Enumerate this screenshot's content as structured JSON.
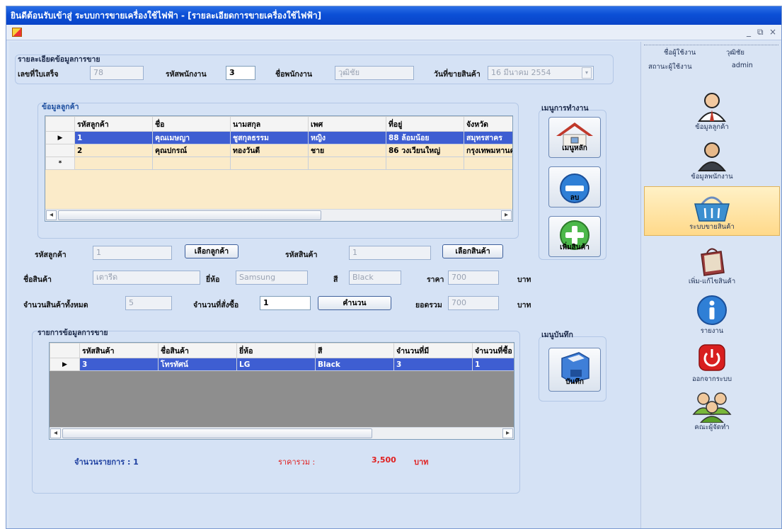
{
  "window": {
    "title": "ยินดีต้อนรับเข้าสู่ ระบบการขายเครื่องใช้ไฟฟ้า - [รายละเอียดการขายเครื่องใช้ไฟฟ้า]",
    "controls": [
      "_",
      "⧉",
      "×"
    ]
  },
  "sale_header": {
    "group_label": "รายละเอียดข้อมูลการขาย",
    "receipt_label": "เลขที่ใบเสร็จ",
    "receipt_value": "78",
    "employee_id_label": "รหัสพนักงาน",
    "employee_id_value": "3",
    "employee_name_label": "ชื่อพนักงาน",
    "employee_name_value": "วุฒิชัย",
    "sale_date_label": "วันที่ขายสินค้า",
    "sale_date_value": "16   มีนาคม    2554"
  },
  "customer": {
    "group_label": "ข้อมูลลูกค้า",
    "columns": [
      "รหัสลูกค้า",
      "ชื่อ",
      "นามสกุล",
      "เพศ",
      "ที่อยู่",
      "จังหวัด"
    ],
    "rows": [
      [
        "1",
        "คุณเมษญา",
        "ชูสกุลธรรม",
        "หญิง",
        "88 ล้อมน้อย",
        "สมุทรสาคร"
      ],
      [
        "2",
        "คุณปกรณ์",
        "ทองวันดี",
        "ชาย",
        "86 วงเวียนใหญ่",
        "กรุงเทพมหานคร"
      ]
    ],
    "new_row_marker": "*",
    "selected_marker": "▶"
  },
  "work_menu": {
    "label": "เมนูการทำงาน",
    "home": "เมนูหลัก",
    "delete": "ลบ",
    "add": "เพิ่มสินค้า"
  },
  "form": {
    "customer_id_label": "รหัสลูกค้า",
    "customer_id_value": "1",
    "choose_customer": "เลือกลูกค้า",
    "product_id_label": "รหัสสินค้า",
    "product_id_value": "1",
    "choose_product": "เลือกสินค้า",
    "product_name_label": "ชื่อสินค้า",
    "product_name_value": "เตารีด",
    "brand_label": "ยี่ห้อ",
    "brand_value": "Samsung",
    "color_label": "สี",
    "color_value": "Black",
    "price_label": "ราคา",
    "price_value": "700",
    "baht": "บาท",
    "stock_label": "จำนวนสินค้าทั้งหมด",
    "stock_value": "5",
    "order_qty_label": "จำนวนที่สั่งซื้อ",
    "order_qty_value": "1",
    "calc_button": "คำนวน",
    "total_label": "ยอดรวม",
    "total_value": "700"
  },
  "sales_list": {
    "group_label": "รายการข้อมูลการขาย",
    "columns": [
      "รหัสสินค้า",
      "ชื่อสินค้า",
      "ยี่ห้อ",
      "สี",
      "จำนวนที่มี",
      "จำนวนที่ซื้อ"
    ],
    "rows": [
      [
        "3",
        "โทรทัศน์",
        "LG",
        "Black",
        "3",
        "1"
      ]
    ],
    "count_label": "จำนวนรายการ : 1",
    "sum_label": "ราคารวม :",
    "sum_value": "3,500",
    "sum_unit": "บาท"
  },
  "save_menu": {
    "label": "เมนูบันทึก",
    "save": "บันทึก"
  },
  "sidebar": {
    "user_label": "ชื่อผู้ใช้งาน",
    "user_value": "วุฒิชัย",
    "status_label": "สถานะผู้ใช้งาน",
    "status_value": "admin",
    "items": [
      {
        "label": "ข้อมูลลูกค้า",
        "icon": "customer-icon"
      },
      {
        "label": "ข้อมูลพนักงาน",
        "icon": "employee-icon"
      },
      {
        "label": "ระบบขายสินค้า",
        "icon": "basket-icon"
      },
      {
        "label": "เพิ่ม-แก้ไขสินค้า",
        "icon": "shopping-bag-icon"
      },
      {
        "label": "รายงาน",
        "icon": "info-icon"
      },
      {
        "label": "ออกจากระบบ",
        "icon": "power-icon"
      },
      {
        "label": "คณะผู้จัดทำ",
        "icon": "team-icon"
      }
    ]
  },
  "colors": {
    "selected_row": "#3e5ed2",
    "sum_red": "#e02020",
    "count_blue": "#1d3fa0",
    "titlebar": "#0b4fd6"
  }
}
